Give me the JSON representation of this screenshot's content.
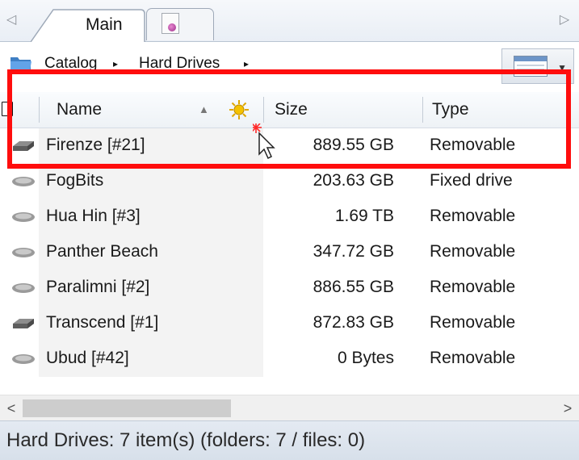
{
  "tabs": {
    "main_label": "Main",
    "scroll_left": "◁",
    "scroll_right": "▷"
  },
  "breadcrumb": {
    "items": [
      "Catalog",
      "Hard Drives"
    ],
    "separator": "▸"
  },
  "columns": {
    "name": "Name",
    "size": "Size",
    "type": "Type",
    "sort_indicator": "▲"
  },
  "rows": [
    {
      "name": "Firenze [#21]",
      "size": "889.55 GB",
      "type": "Removable"
    },
    {
      "name": "FogBits",
      "size": "203.63 GB",
      "type": "Fixed drive"
    },
    {
      "name": "Hua Hin [#3]",
      "size": "1.69 TB",
      "type": "Removable"
    },
    {
      "name": "Panther Beach",
      "size": "347.72 GB",
      "type": "Removable"
    },
    {
      "name": "Paralimni [#2]",
      "size": "886.55 GB",
      "type": "Removable"
    },
    {
      "name": "Transcend [#1]",
      "size": "872.83 GB",
      "type": "Removable"
    },
    {
      "name": "Ubud [#42]",
      "size": "0 Bytes",
      "type": "Removable"
    }
  ],
  "scrollbar": {
    "left_arrow": "<",
    "right_arrow": ">"
  },
  "status": {
    "text": "Hard Drives: 7 item(s) (folders: 7 / files: 0)"
  },
  "icons": {
    "folder": "folder-icon",
    "drive": "hard-drive-icon",
    "document": "document-icon",
    "sun": "sun-icon",
    "view": "grid-view-icon",
    "pointer": "mouse-pointer-icon"
  },
  "colors": {
    "highlight": "#ff0d0d",
    "status_bg": "#dde5ee",
    "name_column_bg": "#f3f3f3"
  }
}
